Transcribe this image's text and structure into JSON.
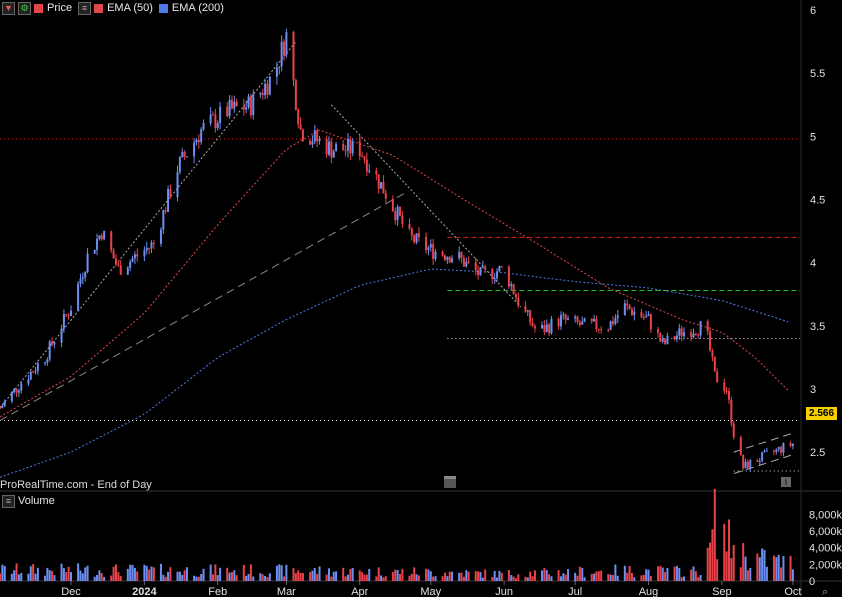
{
  "legend": {
    "price": "Price",
    "ema50": "EMA (50)",
    "ema200": "EMA (200)",
    "volume": "Volume"
  },
  "credit": "ProRealTime.com - End of Day",
  "last_price": "2.566",
  "colors": {
    "up": "#6d8ff0",
    "down": "#e8434a",
    "ema50": "#e0474a",
    "ema200": "#4f7be8",
    "bg": "#000000",
    "axis_text": "#e0e0e0"
  },
  "chart_data": {
    "type": "candlestick",
    "price_axis": {
      "ylim": [
        2.2,
        6.08
      ],
      "ticks": [
        "6",
        "5.5",
        "5",
        "4.5",
        "4",
        "3.5",
        "3",
        "2.5"
      ]
    },
    "volume_axis": {
      "ylim": [
        0,
        9000
      ],
      "ticks": [
        "8,000k",
        "6,000k",
        "4,000k",
        "2,000k",
        "0"
      ]
    },
    "x_ticks": [
      "Dec",
      "2024",
      "Feb",
      "Mar",
      "Apr",
      "May",
      "Jun",
      "Jul",
      "Aug",
      "Sep",
      "Oct"
    ],
    "close_path": [
      [
        "2023-11-01",
        2.85
      ],
      [
        "2023-11-10",
        3.05
      ],
      [
        "2023-11-20",
        3.25
      ],
      [
        "2023-12-01",
        3.65
      ],
      [
        "2023-12-08",
        4.05
      ],
      [
        "2023-12-14",
        4.25
      ],
      [
        "2023-12-21",
        3.95
      ],
      [
        "2024-01-05",
        4.15
      ],
      [
        "2024-01-15",
        4.75
      ],
      [
        "2024-01-25",
        5.05
      ],
      [
        "2024-02-05",
        5.2
      ],
      [
        "2024-02-15",
        5.25
      ],
      [
        "2024-02-25",
        5.5
      ],
      [
        "2024-03-01",
        5.8
      ],
      [
        "2024-03-07",
        5.05
      ],
      [
        "2024-03-20",
        4.9
      ],
      [
        "2024-04-01",
        4.9
      ],
      [
        "2024-04-12",
        4.55
      ],
      [
        "2024-04-22",
        4.2
      ],
      [
        "2024-05-01",
        4.1
      ],
      [
        "2024-05-12",
        4.05
      ],
      [
        "2024-05-22",
        3.9
      ],
      [
        "2024-06-01",
        3.95
      ],
      [
        "2024-06-08",
        3.65
      ],
      [
        "2024-06-15",
        3.45
      ],
      [
        "2024-06-25",
        3.55
      ],
      [
        "2024-07-05",
        3.5
      ],
      [
        "2024-07-15",
        3.5
      ],
      [
        "2024-07-22",
        3.65
      ],
      [
        "2024-08-01",
        3.55
      ],
      [
        "2024-08-07",
        3.35
      ],
      [
        "2024-08-15",
        3.45
      ],
      [
        "2024-08-25",
        3.5
      ],
      [
        "2024-08-29",
        3.1
      ],
      [
        "2024-09-03",
        3.0
      ],
      [
        "2024-09-06",
        2.65
      ],
      [
        "2024-09-10",
        2.38
      ],
      [
        "2024-09-17",
        2.45
      ],
      [
        "2024-09-25",
        2.52
      ],
      [
        "2024-10-01",
        2.566
      ]
    ],
    "ema50": [
      [
        "2023-11-01",
        2.78
      ],
      [
        "2023-12-01",
        3.1
      ],
      [
        "2024-01-01",
        3.6
      ],
      [
        "2024-02-01",
        4.3
      ],
      [
        "2024-03-01",
        4.9
      ],
      [
        "2024-03-15",
        5.05
      ],
      [
        "2024-04-15",
        4.85
      ],
      [
        "2024-05-15",
        4.5
      ],
      [
        "2024-06-15",
        4.15
      ],
      [
        "2024-07-15",
        3.8
      ],
      [
        "2024-08-15",
        3.55
      ],
      [
        "2024-09-01",
        3.45
      ],
      [
        "2024-09-15",
        3.25
      ],
      [
        "2024-10-01",
        2.95
      ]
    ],
    "ema200": [
      [
        "2023-11-01",
        2.3
      ],
      [
        "2023-12-01",
        2.5
      ],
      [
        "2024-01-01",
        2.8
      ],
      [
        "2024-02-01",
        3.25
      ],
      [
        "2024-03-01",
        3.55
      ],
      [
        "2024-04-01",
        3.82
      ],
      [
        "2024-05-01",
        3.95
      ],
      [
        "2024-06-01",
        3.92
      ],
      [
        "2024-07-01",
        3.85
      ],
      [
        "2024-08-01",
        3.8
      ],
      [
        "2024-09-01",
        3.7
      ],
      [
        "2024-10-01",
        3.52
      ]
    ],
    "horizontal_levels": [
      {
        "price": 4.98,
        "style": "dotted",
        "color": "#e02020",
        "from": "2023-11-01"
      },
      {
        "price": 4.2,
        "style": "dashed",
        "color": "#e02020",
        "from": "2024-05-08"
      },
      {
        "price": 3.78,
        "style": "dashed",
        "color": "#20c020",
        "from": "2024-05-08"
      },
      {
        "price": 3.4,
        "style": "dotted",
        "color": "#dddddd",
        "from": "2024-05-08"
      },
      {
        "price": 2.75,
        "style": "dotted",
        "color": "#dddddd",
        "from": "2023-11-01"
      },
      {
        "price": 2.35,
        "style": "dotted",
        "color": "#dddddd",
        "from": "2024-09-06"
      }
    ],
    "trend_lines": [
      {
        "from": [
          "2023-11-01",
          2.85
        ],
        "to": [
          "2024-03-05",
          5.75
        ],
        "style": "dotted"
      },
      {
        "from": [
          "2023-11-01",
          2.75
        ],
        "to": [
          "2024-04-20",
          4.55
        ],
        "style": "dashed"
      },
      {
        "from": [
          "2024-03-20",
          5.25
        ],
        "to": [
          "2024-06-08",
          3.65
        ],
        "style": "dotted"
      },
      {
        "from": [
          "2024-09-06",
          2.5
        ],
        "to": [
          "2024-10-01",
          2.65
        ],
        "style": "dashed"
      },
      {
        "from": [
          "2024-09-06",
          2.33
        ],
        "to": [
          "2024-10-01",
          2.48
        ],
        "style": "dashed"
      }
    ],
    "volume_profile": [
      [
        "2023-11-01",
        1400
      ],
      [
        "2024-03-01",
        1300
      ],
      [
        "2024-05-01",
        1100
      ],
      [
        "2024-06-01",
        900
      ],
      [
        "2024-07-20",
        1300
      ],
      [
        "2024-08-25",
        1200
      ],
      [
        "2024-08-29",
        7500
      ],
      [
        "2024-09-05",
        4500
      ],
      [
        "2024-09-12",
        3000
      ],
      [
        "2024-10-01",
        2200
      ]
    ]
  }
}
